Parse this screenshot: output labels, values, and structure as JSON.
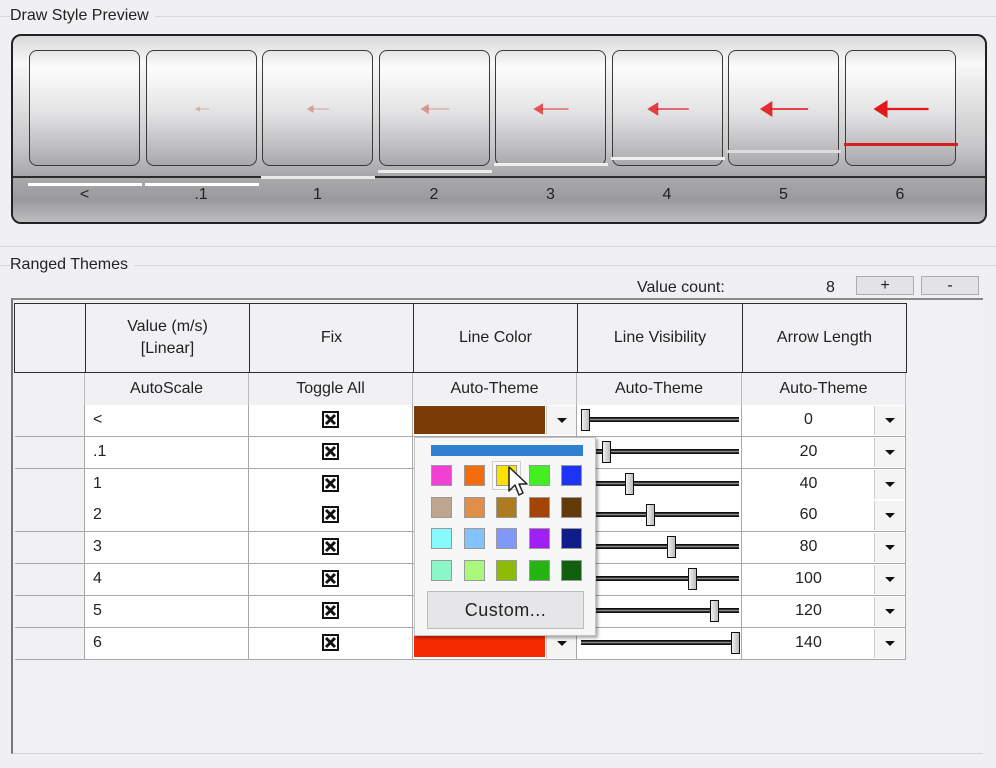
{
  "draw_style_preview": {
    "title": "Draw Style Preview",
    "boxes": [
      {
        "label": "<",
        "arrow_scale": 0,
        "line_color": "#ffffff",
        "line_level": 0
      },
      {
        "label": ".1",
        "arrow_scale": 0.1,
        "line_color": "#ffffff",
        "line_level": 0
      },
      {
        "label": "1",
        "arrow_scale": 0.28,
        "line_color": "#e8e8e8",
        "line_level": 1
      },
      {
        "label": "2",
        "arrow_scale": 0.42,
        "line_color": "#ececec",
        "line_level": 2
      },
      {
        "label": "3",
        "arrow_scale": 0.56,
        "line_color": "#eeeeee",
        "line_level": 3
      },
      {
        "label": "4",
        "arrow_scale": 0.7,
        "line_color": "#f0f0f0",
        "line_level": 4
      },
      {
        "label": "5",
        "arrow_scale": 0.85,
        "line_color": "#dcdcdc",
        "line_level": 5
      },
      {
        "label": "6",
        "arrow_scale": 1.0,
        "line_color": "#d42020",
        "line_level": 6
      }
    ]
  },
  "ranged_themes": {
    "title": "Ranged Themes",
    "value_count_label": "Value count:",
    "value_count": "8",
    "plus_label": "+",
    "minus_label": "-",
    "columns": [
      {
        "header": "Value (m/s)\n[Linear]",
        "header_line1": "Value (m/s)",
        "header_line2": "[Linear]",
        "sub": "AutoScale"
      },
      {
        "header_line1": "Fix",
        "sub": "Toggle All"
      },
      {
        "header_line1": "Line Color",
        "sub": "Auto-Theme"
      },
      {
        "header_line1": "Line Visibility",
        "sub": "Auto-Theme"
      },
      {
        "header_line1": "Arrow Length",
        "sub": "Auto-Theme"
      }
    ],
    "rows": [
      {
        "value": "<",
        "fix": true,
        "line_color": "#7a3a06",
        "visibility": 0.0,
        "arrow_length": "0"
      },
      {
        "value": ".1",
        "fix": true,
        "line_color": "#7a3a06",
        "visibility": 0.14,
        "arrow_length": "20"
      },
      {
        "value": "1",
        "fix": true,
        "line_color": "#7a3a06",
        "visibility": 0.29,
        "arrow_length": "40"
      },
      {
        "value": "2",
        "fix": true,
        "line_color": "#7a3a06",
        "visibility": 0.43,
        "arrow_length": "60"
      },
      {
        "value": "3",
        "fix": true,
        "line_color": "#7a3a06",
        "visibility": 0.57,
        "arrow_length": "80"
      },
      {
        "value": "4",
        "fix": true,
        "line_color": "#7a3a06",
        "visibility": 0.71,
        "arrow_length": "100"
      },
      {
        "value": "5",
        "fix": true,
        "line_color": "#7a3a06",
        "visibility": 0.86,
        "arrow_length": "120"
      },
      {
        "value": "6",
        "fix": true,
        "line_color": "#f52a00",
        "visibility": 1.0,
        "arrow_length": "140"
      }
    ]
  },
  "color_palette": {
    "top_bar_color": "#2f80d0",
    "colors": [
      [
        "#f23fd4",
        "#f56c0c",
        "#fde000",
        "#44ee20",
        "#1c34f4"
      ],
      [
        "#bea68e",
        "#e08e48",
        "#ad7c20",
        "#a44406",
        "#633a0a"
      ],
      [
        "#88fafc",
        "#84c2fc",
        "#8098f8",
        "#a020f4",
        "#101c88"
      ],
      [
        "#8cf6c8",
        "#a8f87c",
        "#8cbc08",
        "#24b414",
        "#106010"
      ]
    ],
    "hovered": [
      0,
      2
    ],
    "custom_label": "Custom..."
  }
}
